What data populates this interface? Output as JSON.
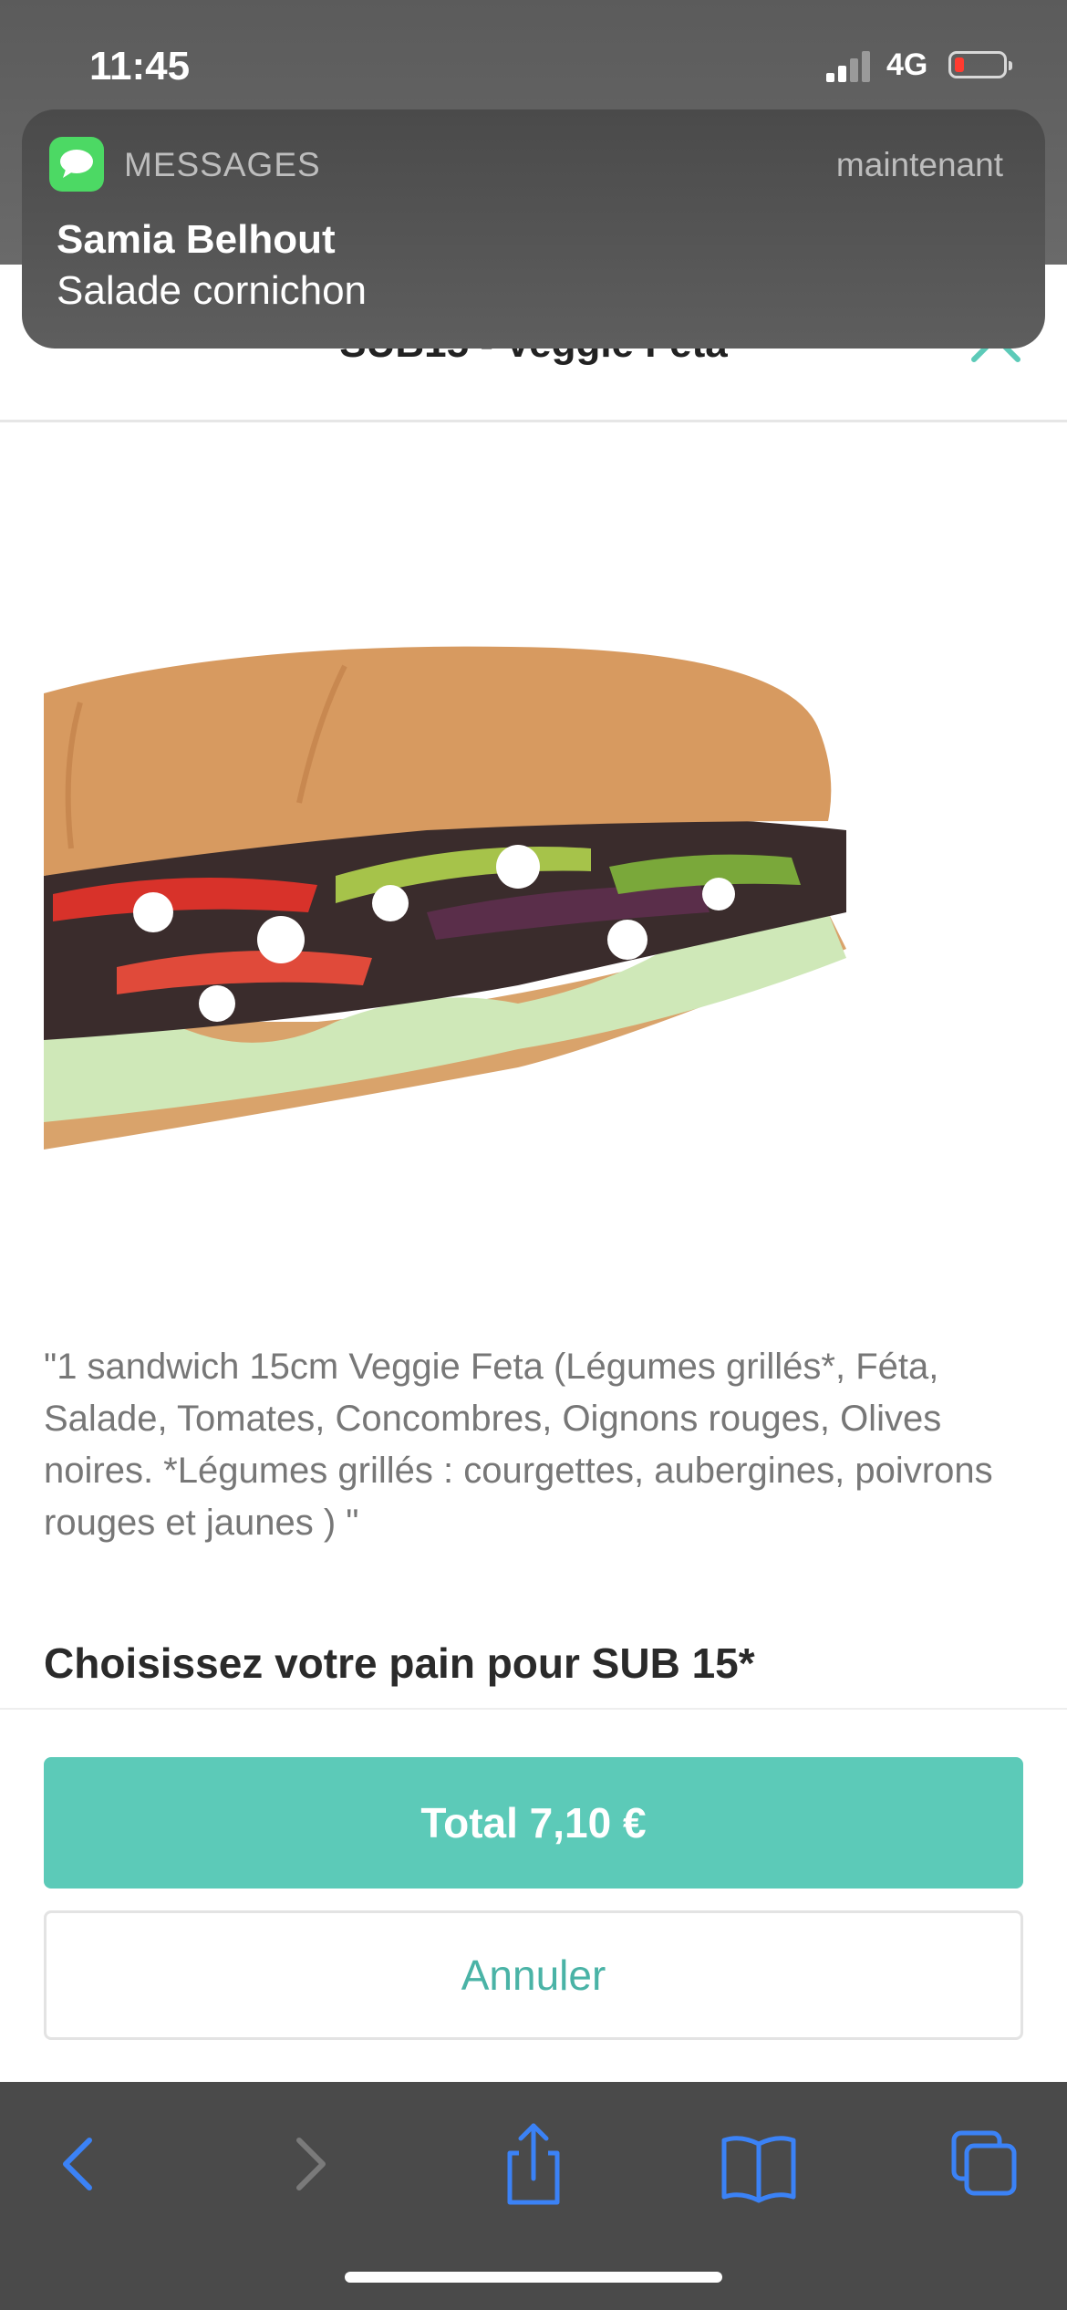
{
  "status_bar": {
    "time": "11:45",
    "network": "4G"
  },
  "notification": {
    "app": "MESSAGES",
    "when": "maintenant",
    "sender": "Samia Belhout",
    "body": "Salade cornichon"
  },
  "sheet": {
    "title": "SUB15 - Veggie Feta",
    "description": "\"1 sandwich 15cm Veggie Feta (Légumes grillés*, Féta, Salade, Tomates, Concombres, Oignons rouges, Olives noires. *Légumes grillés : courgettes, aubergines, poivrons rouges et jaunes ) \"",
    "section_title": "Choisissez votre pain pour SUB 15*"
  },
  "footer": {
    "total_label": "Total 7,10 €",
    "cancel_label": "Annuler"
  },
  "colors": {
    "accent": "#5ccab8",
    "accent_text": "#4ab3a6",
    "safari_icons": "#3b82f6"
  },
  "icons": {
    "close": "chevron-up-icon",
    "app": "messages-icon",
    "back": "back-icon",
    "forward": "forward-icon",
    "share": "share-icon",
    "bookmarks": "bookmarks-icon",
    "tabs": "tabs-icon"
  }
}
